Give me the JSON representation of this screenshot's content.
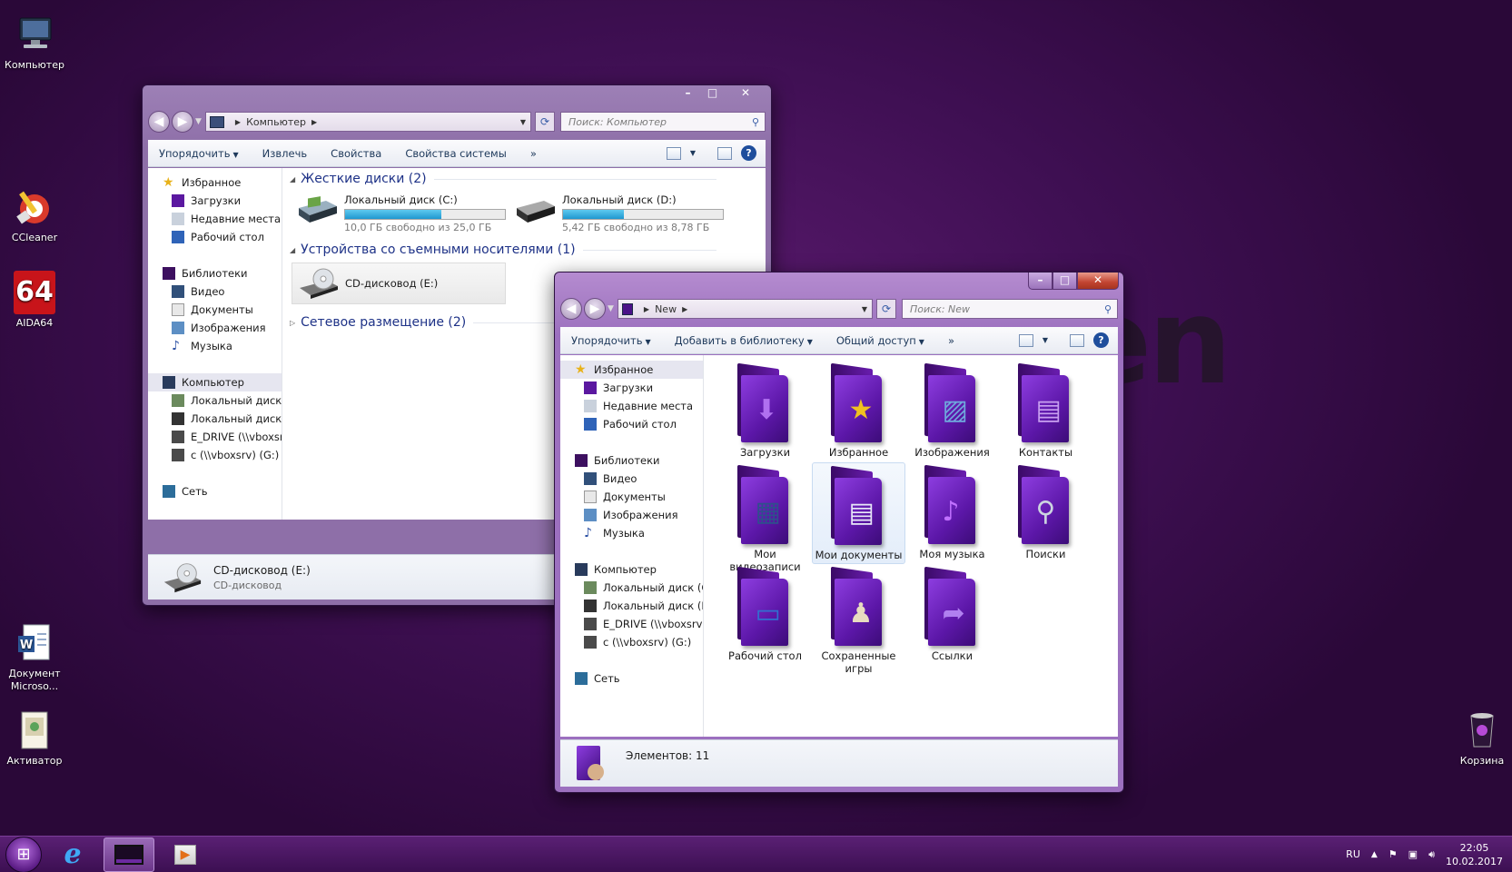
{
  "desktop": {
    "brand_text": "en",
    "icons": [
      {
        "label": "Компьютер",
        "icon": "computer-icon"
      },
      {
        "label": "CCleaner",
        "icon": "ccleaner-icon"
      },
      {
        "label": "AIDA64",
        "icon": "aida64-icon",
        "badge": "64"
      },
      {
        "label": "Документ Microso...",
        "icon": "word-document-icon"
      },
      {
        "label": "Активатор",
        "icon": "activator-icon"
      },
      {
        "label": "Корзина",
        "icon": "recycle-bin-icon"
      }
    ]
  },
  "computer_window": {
    "address": "Компьютер",
    "search_placeholder": "Поиск: Компьютер",
    "toolbar": [
      "Упорядочить",
      "Извлечь",
      "Свойства",
      "Свойства системы",
      "»"
    ],
    "nav": {
      "favorites": "Избранное",
      "fav_items": [
        "Загрузки",
        "Недавние места",
        "Рабочий стол"
      ],
      "libraries": "Библиотеки",
      "lib_items": [
        "Видео",
        "Документы",
        "Изображения",
        "Музыка"
      ],
      "computer": "Компьютер",
      "comp_items": [
        "Локальный диск (C",
        "Локальный диск (D",
        "E_DRIVE (\\\\vboxsrv)",
        "c (\\\\vboxsrv) (G:)"
      ],
      "network": "Сеть"
    },
    "groups": {
      "hard_disks": "Жесткие диски (2)",
      "removable": "Устройства со съемными носителями (1)",
      "network": "Сетевое размещение (2)"
    },
    "drives": [
      {
        "name": "Локальный диск (C:)",
        "free": "10,0 ГБ свободно из 25,0 ГБ",
        "used_fraction": 0.6
      },
      {
        "name": "Локальный диск (D:)",
        "free": "5,42 ГБ свободно из 8,78 ГБ",
        "used_fraction": 0.38
      }
    ],
    "cd_drive": "CD-дисковод (E:)",
    "status": {
      "title": "CD-дисковод (E:)",
      "subtitle": "CD-дисковод"
    }
  },
  "new_window": {
    "address": "New",
    "search_placeholder": "Поиск: New",
    "toolbar": [
      "Упорядочить",
      "Добавить в библиотеку",
      "Общий доступ",
      "»"
    ],
    "nav": {
      "favorites": "Избранное",
      "fav_items": [
        "Загрузки",
        "Недавние места",
        "Рабочий стол"
      ],
      "libraries": "Библиотеки",
      "lib_items": [
        "Видео",
        "Документы",
        "Изображения",
        "Музыка"
      ],
      "computer": "Компьютер",
      "comp_items": [
        "Локальный диск (C",
        "Локальный диск (D",
        "E_DRIVE (\\\\vboxsrv)",
        "c (\\\\vboxsrv) (G:)"
      ],
      "network": "Сеть"
    },
    "folders": [
      {
        "label": "Загрузки",
        "emblem": "download-arrow-icon"
      },
      {
        "label": "Избранное",
        "emblem": "star-icon"
      },
      {
        "label": "Изображения",
        "emblem": "picture-icon"
      },
      {
        "label": "Контакты",
        "emblem": "contacts-icon"
      },
      {
        "label": "Мои видеозаписи",
        "emblem": "film-icon"
      },
      {
        "label": "Мои документы",
        "emblem": "document-icon"
      },
      {
        "label": "Моя музыка",
        "emblem": "music-note-icon"
      },
      {
        "label": "Поиски",
        "emblem": "magnifier-icon"
      },
      {
        "label": "Рабочий стол",
        "emblem": "monitor-icon"
      },
      {
        "label": "Сохраненные игры",
        "emblem": "chess-icon"
      },
      {
        "label": "Ссылки",
        "emblem": "link-arrow-icon"
      }
    ],
    "status": "Элементов: 11"
  },
  "taskbar": {
    "lang": "RU",
    "time": "22:05",
    "date": "10.02.2017"
  },
  "colors": {
    "accent": "#5a1a6e",
    "selection": "#e3edfa",
    "progress": "#1f98d0"
  }
}
